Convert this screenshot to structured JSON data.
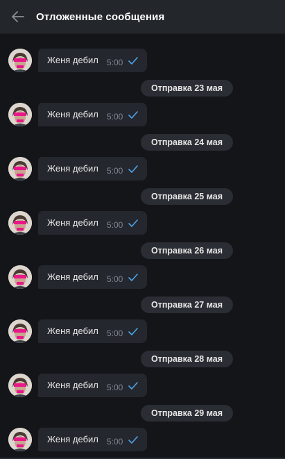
{
  "header": {
    "title": "Отложенные сообщения",
    "back_icon": "arrow-left-icon"
  },
  "colors": {
    "background": "#141519",
    "header": "#23262b",
    "bubble": "#24272d",
    "pill": "#2a2d33",
    "check": "#4fa3e6"
  },
  "messages": [
    {
      "text": "Женя дебил",
      "time": "5:00",
      "status_icon": "check-icon"
    },
    {
      "text": "Женя дебил",
      "time": "5:00",
      "status_icon": "check-icon"
    },
    {
      "text": "Женя дебил",
      "time": "5:00",
      "status_icon": "check-icon"
    },
    {
      "text": "Женя дебил",
      "time": "5:00",
      "status_icon": "check-icon"
    },
    {
      "text": "Женя дебил",
      "time": "5:00",
      "status_icon": "check-icon"
    },
    {
      "text": "Женя дебил",
      "time": "5:00",
      "status_icon": "check-icon"
    },
    {
      "text": "Женя дебил",
      "time": "5:00",
      "status_icon": "check-icon"
    },
    {
      "text": "Женя дебил",
      "time": "5:00",
      "status_icon": "check-icon"
    }
  ],
  "date_separators": [
    {
      "label": "Отправка 23 мая"
    },
    {
      "label": "Отправка 24 мая"
    },
    {
      "label": "Отправка 25 мая"
    },
    {
      "label": "Отправка 26 мая"
    },
    {
      "label": "Отправка 27 мая"
    },
    {
      "label": "Отправка 28 мая"
    },
    {
      "label": "Отправка 29 мая"
    }
  ]
}
